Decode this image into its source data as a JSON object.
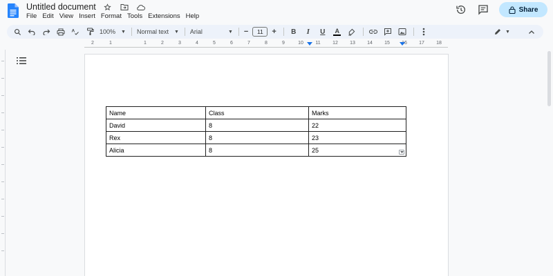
{
  "app": {
    "title": "Untitled document",
    "share_label": "Share"
  },
  "menu": [
    "File",
    "Edit",
    "View",
    "Insert",
    "Format",
    "Tools",
    "Extensions",
    "Help"
  ],
  "toolbar": {
    "zoom": "100%",
    "style": "Normal text",
    "font": "Arial",
    "font_size": "11",
    "minus": "−",
    "plus": "+",
    "bold": "B",
    "italic": "I",
    "underline": "U",
    "text_color": "A"
  },
  "ruler": {
    "labels": [
      "2",
      "1",
      "1",
      "2",
      "3",
      "4",
      "5",
      "6",
      "7",
      "8",
      "9",
      "10",
      "11",
      "12",
      "13",
      "14",
      "15",
      "16",
      "17",
      "18"
    ]
  },
  "table": {
    "rows": [
      [
        "Name",
        "Class",
        "Marks"
      ],
      [
        "David",
        "8",
        "22"
      ],
      [
        "Rex",
        "8",
        "23"
      ],
      [
        "Alicia",
        "8",
        "25"
      ]
    ]
  },
  "colors": {
    "accent": "#1a73e8",
    "share_bg": "#c2e7ff",
    "toolbar_bg": "#edf2fa"
  }
}
